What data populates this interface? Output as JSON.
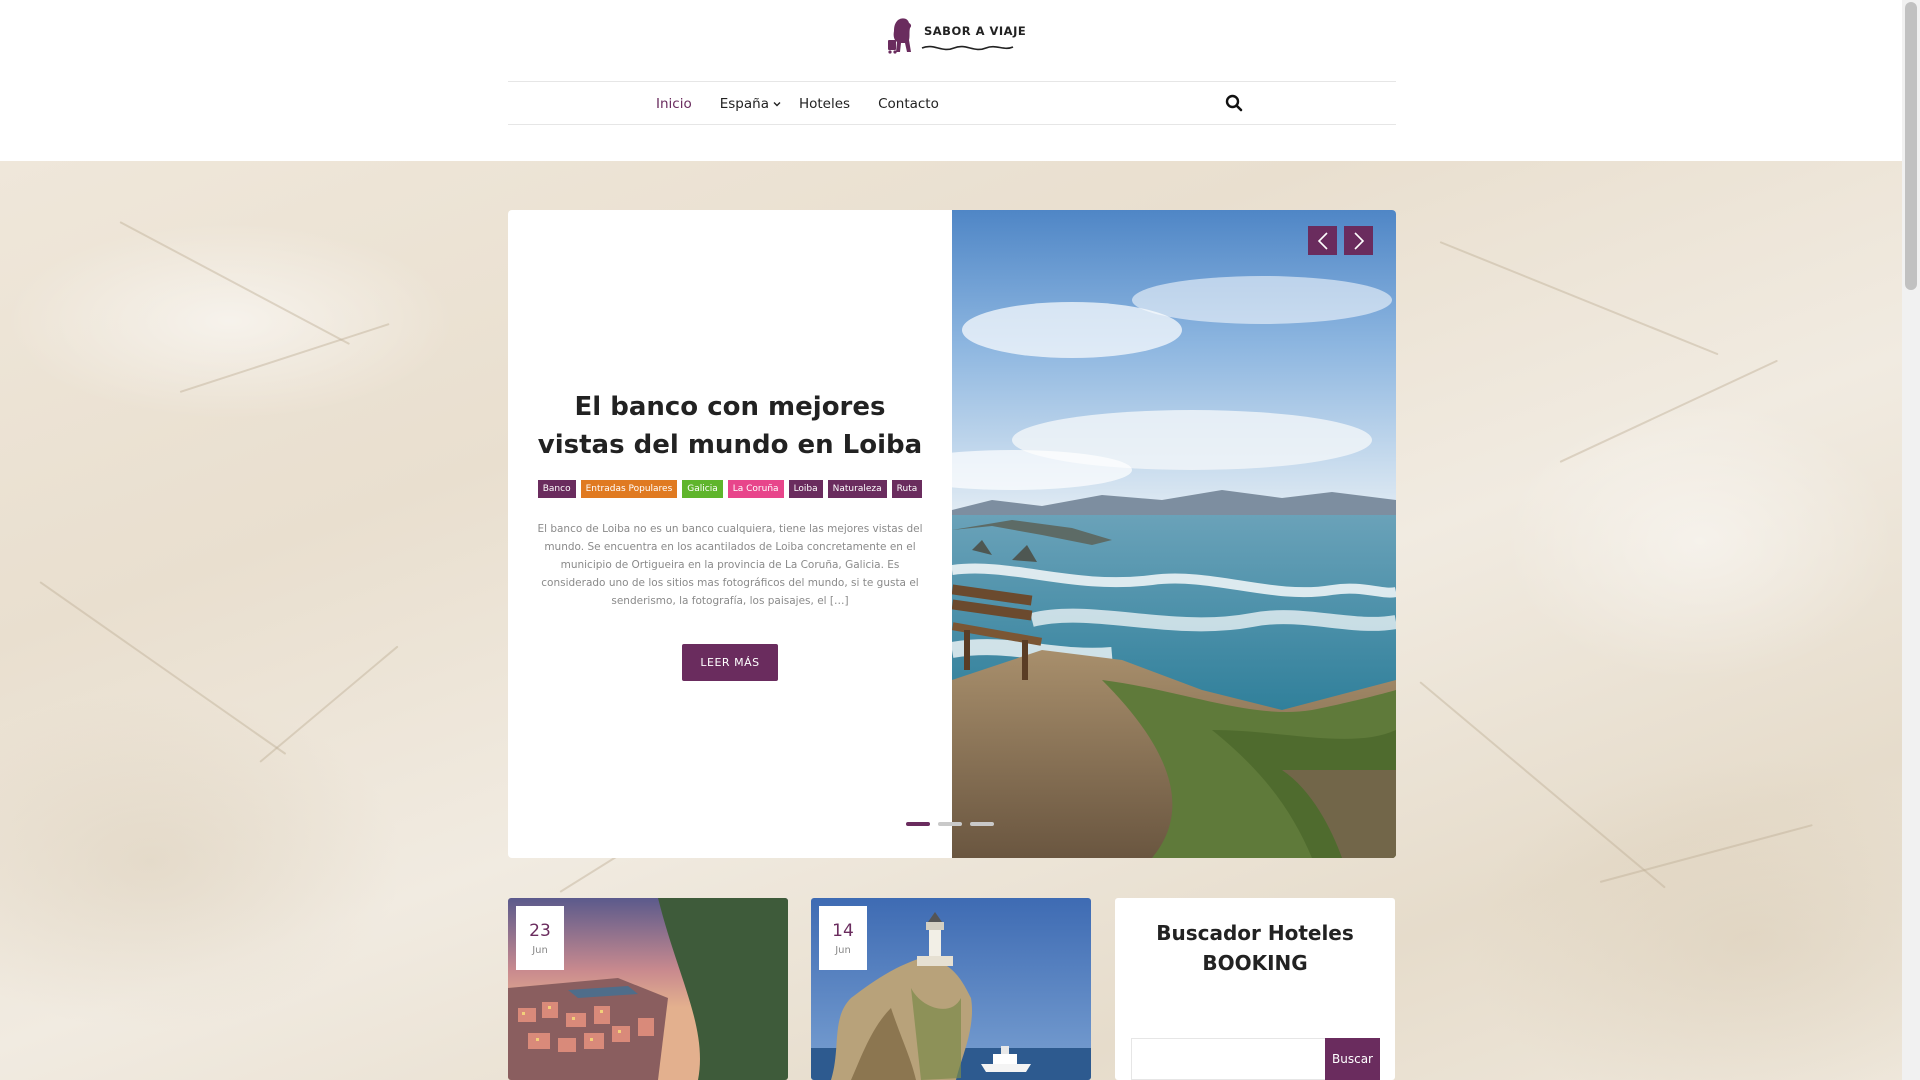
{
  "brand": {
    "logo_text": "SABOR A VIAJE"
  },
  "nav": {
    "items": [
      {
        "label": "Inicio",
        "active": true
      },
      {
        "label": "España",
        "dropdown": true
      },
      {
        "label": "Hoteles"
      },
      {
        "label": "Contacto"
      }
    ]
  },
  "icons": {
    "search": "search-icon",
    "dropdown": "chevron-down-icon",
    "prev": "chevron-left-icon",
    "next": "chevron-right-icon"
  },
  "colors": {
    "accent": "#6a2c5e",
    "tag_orange": "#e07a21",
    "tag_green": "#5fb52c",
    "tag_pink": "#e8458b",
    "tag_purple": "#6a2c5e"
  },
  "slider": {
    "title": "El banco con mejores vistas del mundo en Loiba",
    "tags": [
      {
        "label": "Banco",
        "color": "#6a2c5e"
      },
      {
        "label": "Entradas Populares",
        "color": "#e07a21"
      },
      {
        "label": "Galicia",
        "color": "#5fb52c"
      },
      {
        "label": "La Coruña",
        "color": "#e8458b"
      },
      {
        "label": "Loiba",
        "color": "#6a2c5e"
      },
      {
        "label": "Naturaleza",
        "color": "#6a2c5e"
      },
      {
        "label": "Ruta",
        "color": "#6a2c5e"
      }
    ],
    "excerpt": "El banco de Loiba no es un banco cualquiera, tiene las mejores vistas del mundo. Se encuentra en los acantilados de Loiba concretamente en el municipio de Ortigueira en la provincia de La Coruña, Galicia. Es considerado uno de los sitios mas fotográficos del mundo, si te gusta el senderismo, la fotografía, los paisajes, el […]",
    "read_more": "LEER MÁS",
    "dots": 3,
    "active_dot": 0
  },
  "posts": [
    {
      "day": "23",
      "month": "Jun"
    },
    {
      "day": "14",
      "month": "Jun"
    }
  ],
  "widget": {
    "title": "Buscador Hoteles BOOKING",
    "button": "Buscar"
  }
}
